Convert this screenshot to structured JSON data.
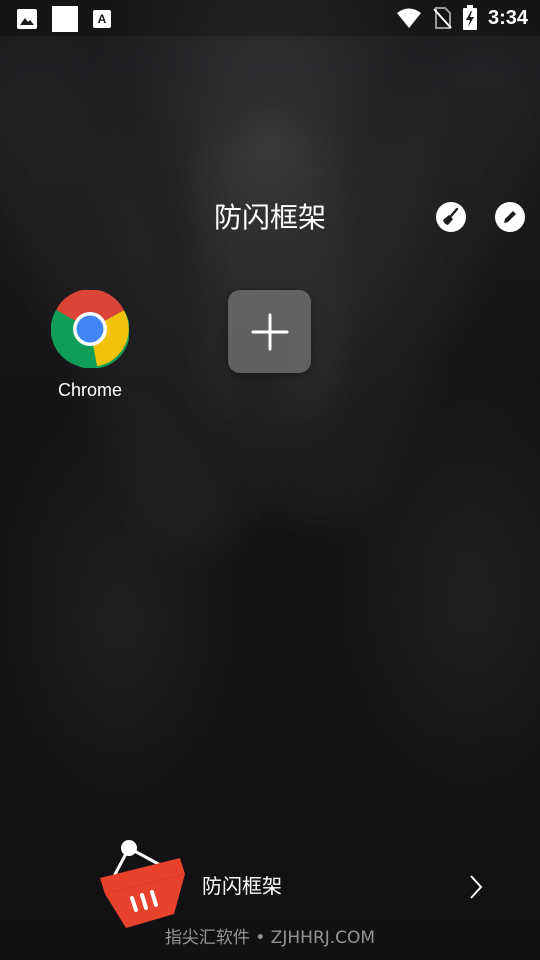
{
  "status_bar": {
    "time": "3:34",
    "left_icons": [
      "image-icon",
      "white-square-icon",
      "a-notification-icon"
    ],
    "right_icons": [
      "wifi-icon",
      "no-sim-icon",
      "battery-charging-icon"
    ]
  },
  "folder": {
    "title": "防闪框架",
    "actions": [
      "broom-icon",
      "pencil-icon"
    ]
  },
  "apps": [
    {
      "label": "Chrome",
      "icon": "chrome-icon"
    }
  ],
  "add_button_icon": "plus-icon",
  "promo": {
    "text": "防闪框架",
    "icon": "basket-icon",
    "arrow": "chevron-right-icon"
  },
  "watermark": "指尖汇软件 • ZJHHRJ.COM",
  "colors": {
    "background": "#141416",
    "chrome_red": "#DB4437",
    "chrome_yellow": "#F4C20D",
    "chrome_green": "#0F9D58",
    "chrome_blue": "#4285F4",
    "basket_red": "#E8412C"
  }
}
